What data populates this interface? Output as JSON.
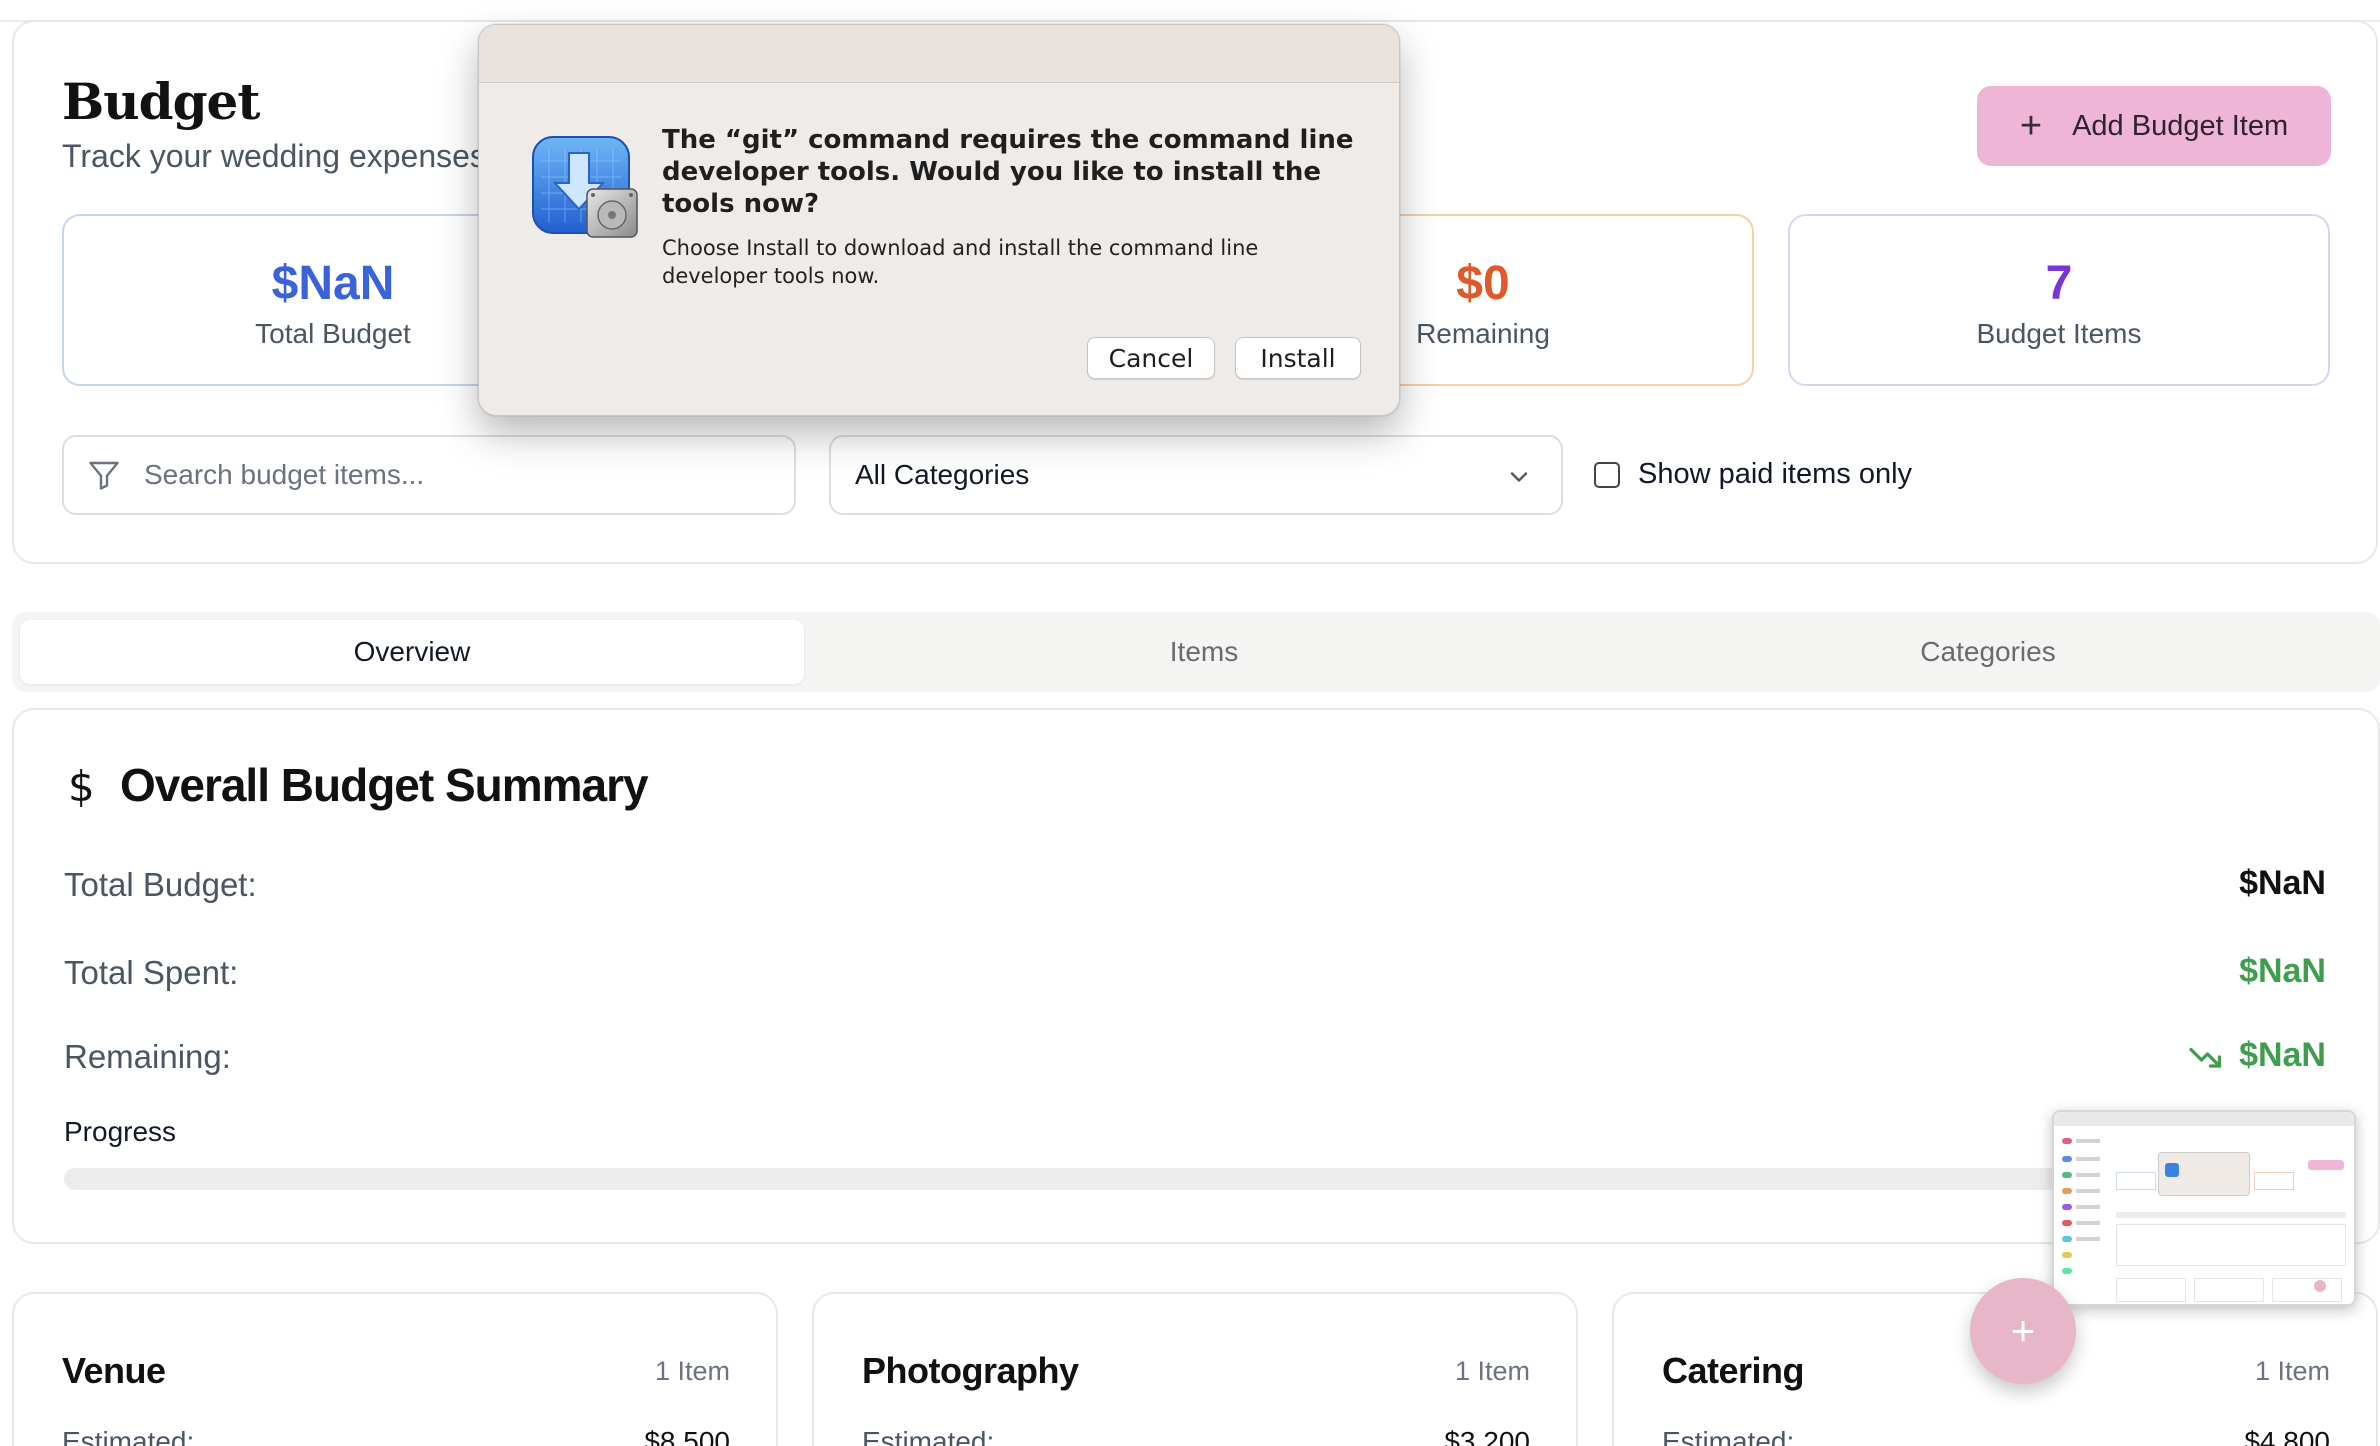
{
  "header": {
    "title": "Budget",
    "subtitle": "Track your wedding expenses",
    "add_button_label": "Add Budget Item"
  },
  "stats": {
    "total": {
      "value": "$NaN",
      "label": "Total Budget"
    },
    "remaining": {
      "value": "$0",
      "label": "Remaining"
    },
    "items": {
      "value": "7",
      "label": "Budget Items"
    }
  },
  "filters": {
    "search_placeholder": "Search budget items...",
    "category_selected": "All Categories",
    "paid_only_label": "Show paid items only",
    "paid_only_checked": false
  },
  "tabs": [
    {
      "label": "Overview",
      "active": true
    },
    {
      "label": "Items",
      "active": false
    },
    {
      "label": "Categories",
      "active": false
    }
  ],
  "summary": {
    "icon": "$",
    "title": "Overall Budget Summary",
    "rows": [
      {
        "label": "Total Budget:",
        "value": "$NaN",
        "color": "#111111"
      },
      {
        "label": "Total Spent:",
        "value": "$NaN",
        "color": "#3f9e4e"
      },
      {
        "label": "Remaining:",
        "value": "$NaN",
        "color": "#3f9e4e",
        "icon": "trending-down-icon"
      }
    ],
    "progress_label": "Progress",
    "progress_fraction": 0
  },
  "categories": [
    {
      "name": "Venue",
      "count": "1 Item",
      "estimated_label": "Estimated:",
      "estimated_value": "$8,500"
    },
    {
      "name": "Photography",
      "count": "1 Item",
      "estimated_label": "Estimated:",
      "estimated_value": "$3,200"
    },
    {
      "name": "Catering",
      "count": "1 Item",
      "estimated_label": "Estimated:",
      "estimated_value": "$4,800"
    }
  ],
  "fab": {
    "icon": "plus-icon",
    "label": "+"
  },
  "dialog": {
    "message": "The “git” command requires the command line developer tools. Would you like to install the tools now?",
    "informative": "Choose Install to download and install the command line developer tools now.",
    "cancel_label": "Cancel",
    "install_label": "Install",
    "icon": "developer-tools-installer-icon"
  },
  "colors": {
    "accent_pink": "#eeb5d6",
    "total_blue": "#3b63d9",
    "remaining_orange": "#dd5a2a",
    "items_purple": "#7a35d6",
    "positive_green": "#3f9e4e"
  }
}
